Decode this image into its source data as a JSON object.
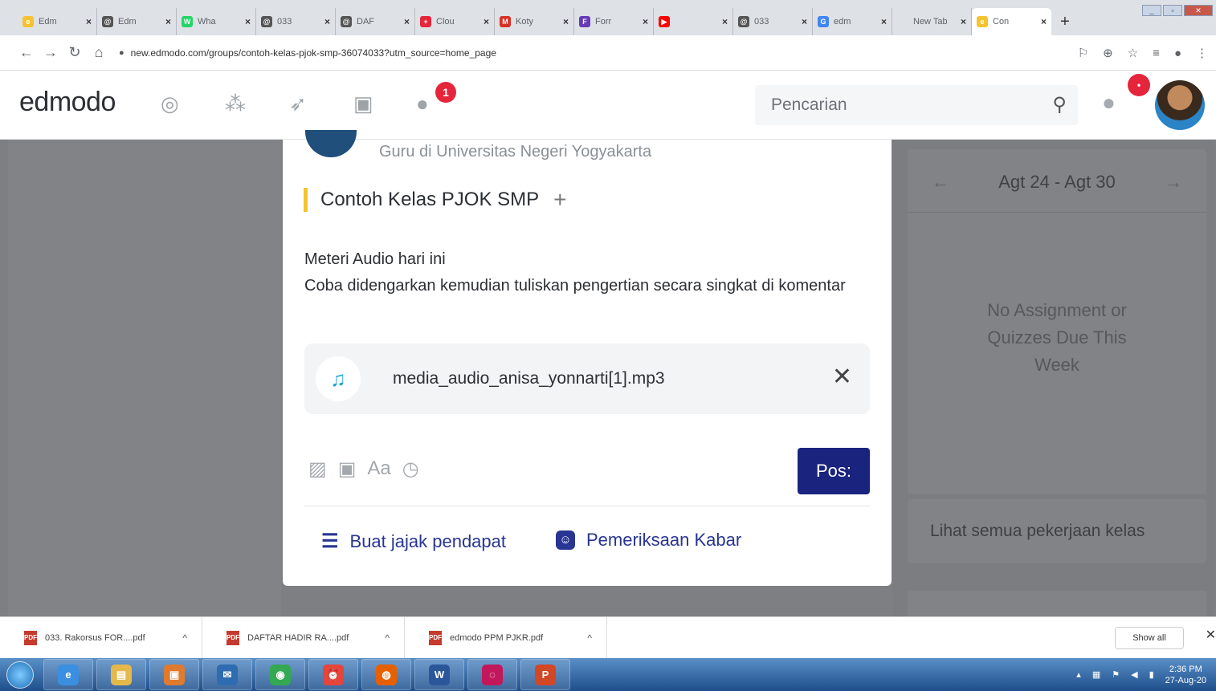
{
  "browser": {
    "tabs": [
      {
        "title": "Edm",
        "icon_color": "#f4c430",
        "glyph": "e"
      },
      {
        "title": "Edm",
        "icon_color": "#555555",
        "glyph": "@"
      },
      {
        "title": "Wha",
        "icon_color": "#25d366",
        "glyph": "W"
      },
      {
        "title": "033",
        "icon_color": "#555555",
        "glyph": "@"
      },
      {
        "title": "DAF",
        "icon_color": "#555555",
        "glyph": "@"
      },
      {
        "title": "Clou",
        "icon_color": "#e5253b",
        "glyph": "+"
      },
      {
        "title": "Koty",
        "icon_color": "#d93025",
        "glyph": "M"
      },
      {
        "title": "Forr",
        "icon_color": "#673ab7",
        "glyph": "F"
      },
      {
        "title": "",
        "icon_color": "#ff0000",
        "glyph": "▶"
      },
      {
        "title": "033",
        "icon_color": "#555555",
        "glyph": "@"
      },
      {
        "title": "edm",
        "icon_color": "#4285f4",
        "glyph": "G"
      },
      {
        "title": "New Tab",
        "icon_color": "#dee1e6",
        "glyph": ""
      },
      {
        "title": "Con",
        "icon_color": "#f4c430",
        "glyph": "e"
      }
    ],
    "url": "new.edmodo.com/groups/contoh-kelas-pjok-smp-36074033?utm_source=home_page"
  },
  "app": {
    "logo": "edmodo",
    "chat_badge": "1",
    "search_placeholder": "Pencarian",
    "notif_badge": "•"
  },
  "composer": {
    "teacher_subtitle": "Guru di Universitas Negeri Yogyakarta",
    "class_name": "Contoh Kelas PJOK SMP",
    "body_line1": "Meteri Audio hari ini",
    "body_line2": "Coba didengarkan kemudian tuliskan pengertian secara singkat di komentar",
    "attachment": "media_audio_anisa_yonnarti[1].mp3",
    "text_tool": "Aa",
    "post_button": "Pos:",
    "poll_label": "Buat jajak pendapat",
    "checkin_label": "Pemeriksaan Kabar"
  },
  "sidebar": {
    "week_range": "Agt 24 - Agt 30",
    "no_due": "No Assignment or Quizzes Due This Week",
    "view_all": "Lihat semua pekerjaan kelas"
  },
  "downloads": {
    "files": [
      "033. Rakorsus FOR....pdf",
      "DAFTAR HADIR RA....pdf",
      "edmodo PPM PJKR.pdf"
    ],
    "show_all": "Show all"
  },
  "taskbar": {
    "apps": [
      {
        "name": "ie-icon",
        "color": "#3b8fe0",
        "glyph": "e"
      },
      {
        "name": "explorer-icon",
        "color": "#e6b84a",
        "glyph": "▤"
      },
      {
        "name": "media-icon",
        "color": "#e07a2e",
        "glyph": "▣"
      },
      {
        "name": "mail-icon",
        "color": "#2f6bb0",
        "glyph": "✉"
      },
      {
        "name": "chrome-icon",
        "color": "#34a853",
        "glyph": "◉"
      },
      {
        "name": "alarm-icon",
        "color": "#e5453a",
        "glyph": "⏰"
      },
      {
        "name": "firefox-icon",
        "color": "#e66000",
        "glyph": "◍"
      },
      {
        "name": "word-icon",
        "color": "#2b579a",
        "glyph": "W"
      },
      {
        "name": "swirl-icon",
        "color": "#c2185b",
        "glyph": "◌"
      },
      {
        "name": "powerpoint-icon",
        "color": "#d24726",
        "glyph": "P"
      }
    ],
    "time": "2:36 PM",
    "date": "27-Aug-20"
  }
}
